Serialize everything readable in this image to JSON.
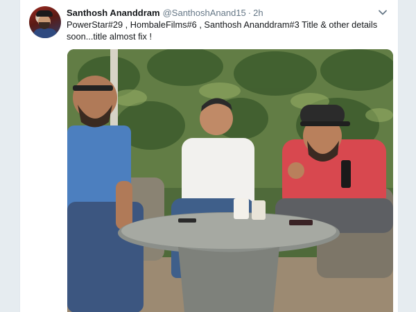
{
  "tweet": {
    "display_name": "Santhosh Ananddram",
    "handle": "@SanthoshAnand15",
    "separator": "·",
    "time": "2h",
    "text": "PowerStar#29 , HombaleFilms#6 , Santhosh Ananddram#3 Title & other details soon...title almost fix !",
    "menu_icon": "chevron-down-icon",
    "avatar_icon": "user-avatar"
  },
  "colors": {
    "name": "#14171a",
    "meta": "#657786",
    "background": "#e6ecf0"
  }
}
